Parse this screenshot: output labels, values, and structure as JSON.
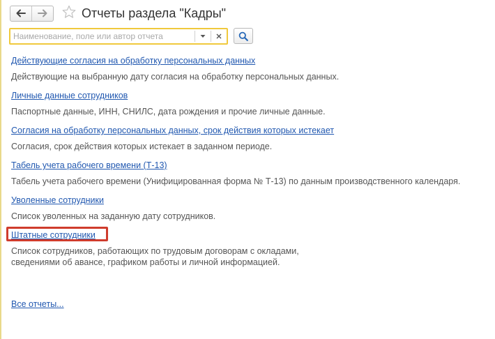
{
  "header": {
    "back_icon": "arrow-left-icon",
    "forward_icon": "arrow-right-icon",
    "favorite_icon": "star-icon",
    "title": "Отчеты раздела \"Кадры\""
  },
  "search": {
    "placeholder": "Наименование, поле или автор отчета",
    "value": "",
    "dropdown_icon": "dropdown-icon",
    "clear_icon": "clear-icon",
    "search_icon": "magnifier-icon"
  },
  "reports": [
    {
      "title": "Действующие согласия на обработку персональных данных",
      "description": [
        "Действующие на выбранную дату согласия на обработку персональных данных."
      ]
    },
    {
      "title": "Личные данные сотрудников",
      "description": [
        "Паспортные данные, ИНН, СНИЛС, дата рождения и прочие личные данные."
      ]
    },
    {
      "title": "Согласия на обработку персональных данных, срок действия которых истекает",
      "description": [
        "Согласия, срок действия которых истекает в заданном периоде."
      ]
    },
    {
      "title": "Табель учета рабочего времени (Т-13)",
      "description": [
        "Табель учета рабочего времени (Унифицированная форма № Т-13) по данным производственного календаря."
      ]
    },
    {
      "title": "Уволенные сотрудники",
      "description": [
        "Список уволенных на заданную дату сотрудников."
      ]
    },
    {
      "title": "Штатные сотрудники",
      "description": [
        "Список сотрудников, работающих по трудовым договорам с окладами,",
        "сведениями об авансе, графиком работы и личной информацией."
      ],
      "highlighted": true
    }
  ],
  "all_reports_label": "Все отчеты...",
  "colors": {
    "link": "#2158b0",
    "description": "#555555",
    "search_border": "#f0c93c",
    "highlight": "#cf3c2d"
  }
}
